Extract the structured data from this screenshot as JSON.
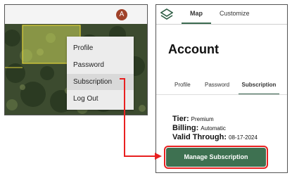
{
  "left": {
    "avatar_letter": "A",
    "menu": [
      {
        "label": "Profile"
      },
      {
        "label": "Password"
      },
      {
        "label": "Subscription"
      },
      {
        "label": "Log Out"
      }
    ]
  },
  "right": {
    "tabs": [
      {
        "label": "Map"
      },
      {
        "label": "Customize"
      }
    ],
    "title": "Account",
    "subtabs": [
      {
        "label": "Profile"
      },
      {
        "label": "Password"
      },
      {
        "label": "Subscription"
      }
    ],
    "tier_label": "Tier:",
    "tier_value": "Premium",
    "billing_label": "Billing:",
    "billing_value": "Automatic",
    "valid_label": "Valid Through:",
    "valid_value": "08-17-2024",
    "manage_label": "Manage Subscription"
  },
  "colors": {
    "accent_green": "#3e7151",
    "highlight_red": "#e82020",
    "avatar_bg": "#a0422a"
  }
}
